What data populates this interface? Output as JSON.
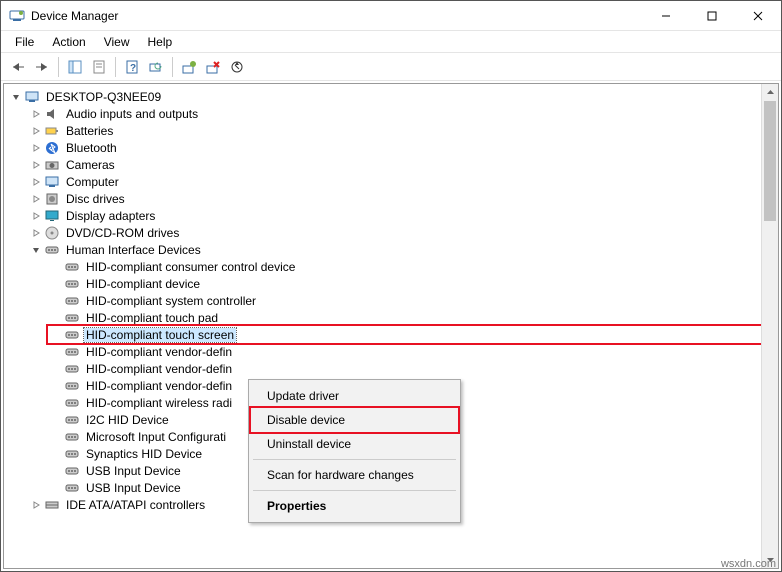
{
  "window": {
    "title": "Device Manager"
  },
  "menu": {
    "file": "File",
    "action": "Action",
    "view": "View",
    "help": "Help"
  },
  "tree": {
    "root": "DESKTOP-Q3NEE09",
    "categories": [
      {
        "label": "Audio inputs and outputs",
        "icon": "audio"
      },
      {
        "label": "Batteries",
        "icon": "battery"
      },
      {
        "label": "Bluetooth",
        "icon": "bluetooth"
      },
      {
        "label": "Cameras",
        "icon": "camera"
      },
      {
        "label": "Computer",
        "icon": "computer"
      },
      {
        "label": "Disc drives",
        "icon": "disc"
      },
      {
        "label": "Display adapters",
        "icon": "display"
      },
      {
        "label": "DVD/CD-ROM drives",
        "icon": "dvd"
      },
      {
        "label": "Human Interface Devices",
        "icon": "hid",
        "expanded": true
      },
      {
        "label": "IDE ATA/ATAPI controllers",
        "icon": "ide"
      }
    ],
    "hid_children": [
      "HID-compliant consumer control device",
      "HID-compliant device",
      "HID-compliant system controller",
      "HID-compliant touch pad",
      "HID-compliant touch screen",
      "HID-compliant vendor-defin",
      "HID-compliant vendor-defin",
      "HID-compliant vendor-defin",
      "HID-compliant wireless radi",
      "I2C HID Device",
      "Microsoft Input Configurati",
      "Synaptics HID Device",
      "USB Input Device",
      "USB Input Device"
    ]
  },
  "context_menu": {
    "update": "Update driver",
    "disable": "Disable device",
    "uninstall": "Uninstall device",
    "scan": "Scan for hardware changes",
    "properties": "Properties"
  },
  "watermark": "wsxdn.com"
}
